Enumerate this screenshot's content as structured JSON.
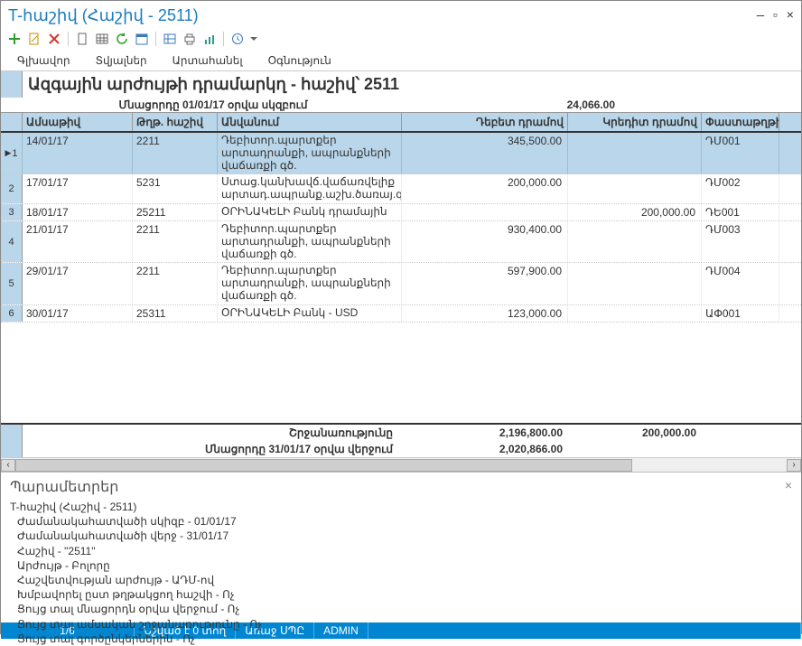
{
  "window": {
    "title": "T-հաշիվ (Հաշիվ - 2511)"
  },
  "menu": {
    "main": "Գլխավոր",
    "data": "Տվյալներ",
    "export": "Արտահանել",
    "help": "Օգնություն"
  },
  "report": {
    "title": "Ազգային արժույթի դրամարկղ - հաշիվ՝ 2511",
    "opening_label": "Մնացորդը 01/01/17 օրվա սկզբում",
    "opening_value": "24,066.00",
    "columns": {
      "date": "Ամսաթիվ",
      "acct": "Թղթ. հաշիվ",
      "name": "Անվանում",
      "debit": "Դեբետ դրամով",
      "credit": "Կրեդիտ դրամով",
      "doc": "Փաստաթղթի N"
    },
    "rows": [
      {
        "n": "1",
        "date": "14/01/17",
        "acct": "2211",
        "name": "Դեբիտոր.պարտքեր արտադրանքի, ապրանքների վաճառքի գծ.",
        "debit": "345,500.00",
        "credit": "",
        "doc": "ԴՄ001"
      },
      {
        "n": "2",
        "date": "17/01/17",
        "acct": "5231",
        "name": "Ստաց.կանխավճ.վաճառվելիք արտադ.ապրանք.աշխ.ծառայ.գծ.",
        "debit": "200,000.00",
        "credit": "",
        "doc": "ԴՄ002"
      },
      {
        "n": "3",
        "date": "18/01/17",
        "acct": "25211",
        "name": "ՕՐԻՆԱԿԵԼԻ Բանկ դրամային",
        "debit": "",
        "credit": "200,000.00",
        "doc": "ԴԵ001"
      },
      {
        "n": "4",
        "date": "21/01/17",
        "acct": "2211",
        "name": "Դեբիտոր.պարտքեր արտադրանքի, ապրանքների վաճառքի գծ.",
        "debit": "930,400.00",
        "credit": "",
        "doc": "ԴՄ003"
      },
      {
        "n": "5",
        "date": "29/01/17",
        "acct": "2211",
        "name": "Դեբիտոր.պարտքեր արտադրանքի, ապրանքների վաճառքի գծ.",
        "debit": "597,900.00",
        "credit": "",
        "doc": "ԴՄ004"
      },
      {
        "n": "6",
        "date": "30/01/17",
        "acct": "25311",
        "name": "ՕՐԻՆԱԿԵԼԻ Բանկ - USD",
        "debit": "123,000.00",
        "credit": "",
        "doc": "ԱՓ001"
      }
    ],
    "turnover_label": "Շրջանառությունը",
    "turnover_debit": "2,196,800.00",
    "turnover_credit": "200,000.00",
    "closing_label": "Մնացորդը 31/01/17 օրվա վերջում",
    "closing_value": "2,020,866.00"
  },
  "params": {
    "heading": "Պարամետրեր",
    "lines": [
      "T-հաշիվ (Հաշիվ - 2511)",
      "Ժամանակահատվածի սկիզբ  - 01/01/17",
      "Ժամանակահատվածի վերջ  - 31/01/17",
      "Հաշիվ  - \"2511\"",
      "Արժույթ  - Բոլորը",
      "Հաշվետվության արժույթ  - ԱԴՄ-ով",
      "Խմբավորել ըստ թղթակցող հաշվի  - Ոչ",
      "Ցույց տալ մնացորդն օրվա վերջում  - Ոչ",
      "Ցույց տալ ամսական շրջանառությունը  - Ոչ",
      "Ցույց տալ գործընկերներին  - Ոչ"
    ]
  },
  "status": {
    "rows": "1/6",
    "marked": "Նշված է 0 տող",
    "sys": "Առաջ ՍՊԸ",
    "user": "ADMIN"
  }
}
